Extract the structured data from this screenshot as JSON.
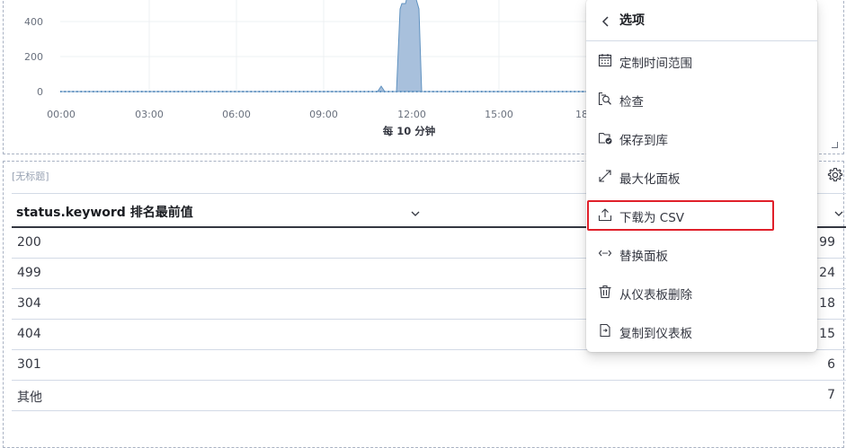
{
  "chart": {
    "y_ticks": [
      "400",
      "200",
      "0"
    ],
    "x_ticks": [
      "00:00",
      "03:00",
      "06:00",
      "09:00",
      "12:00",
      "15:00",
      "18:"
    ],
    "x_axis_title": "每 10 分钟"
  },
  "table_panel": {
    "title": "[无标题]",
    "column_header": "status.keyword 排名最前值",
    "rows": [
      {
        "key": "200",
        "value": "99"
      },
      {
        "key": "499",
        "value": "24"
      },
      {
        "key": "304",
        "value": "18"
      },
      {
        "key": "404",
        "value": "15"
      },
      {
        "key": "301",
        "value": "6"
      },
      {
        "key": "其他",
        "value": "7"
      }
    ]
  },
  "menu": {
    "title": "选项",
    "items": [
      {
        "label": "定制时间范围",
        "icon": "calendar-icon"
      },
      {
        "label": "检查",
        "icon": "inspect-icon"
      },
      {
        "label": "保存到库",
        "icon": "save-to-library-icon"
      },
      {
        "label": "最大化面板",
        "icon": "expand-icon"
      },
      {
        "label": "下载为 CSV",
        "icon": "export-icon"
      },
      {
        "label": "替换面板",
        "icon": "replace-icon"
      },
      {
        "label": "从仪表板删除",
        "icon": "trash-icon"
      },
      {
        "label": "复制到仪表板",
        "icon": "copy-to-dashboard-icon"
      }
    ]
  },
  "colors": {
    "series": "#6092c0",
    "series_fill": "#a8c0dc",
    "highlight": "#e0202a"
  }
}
